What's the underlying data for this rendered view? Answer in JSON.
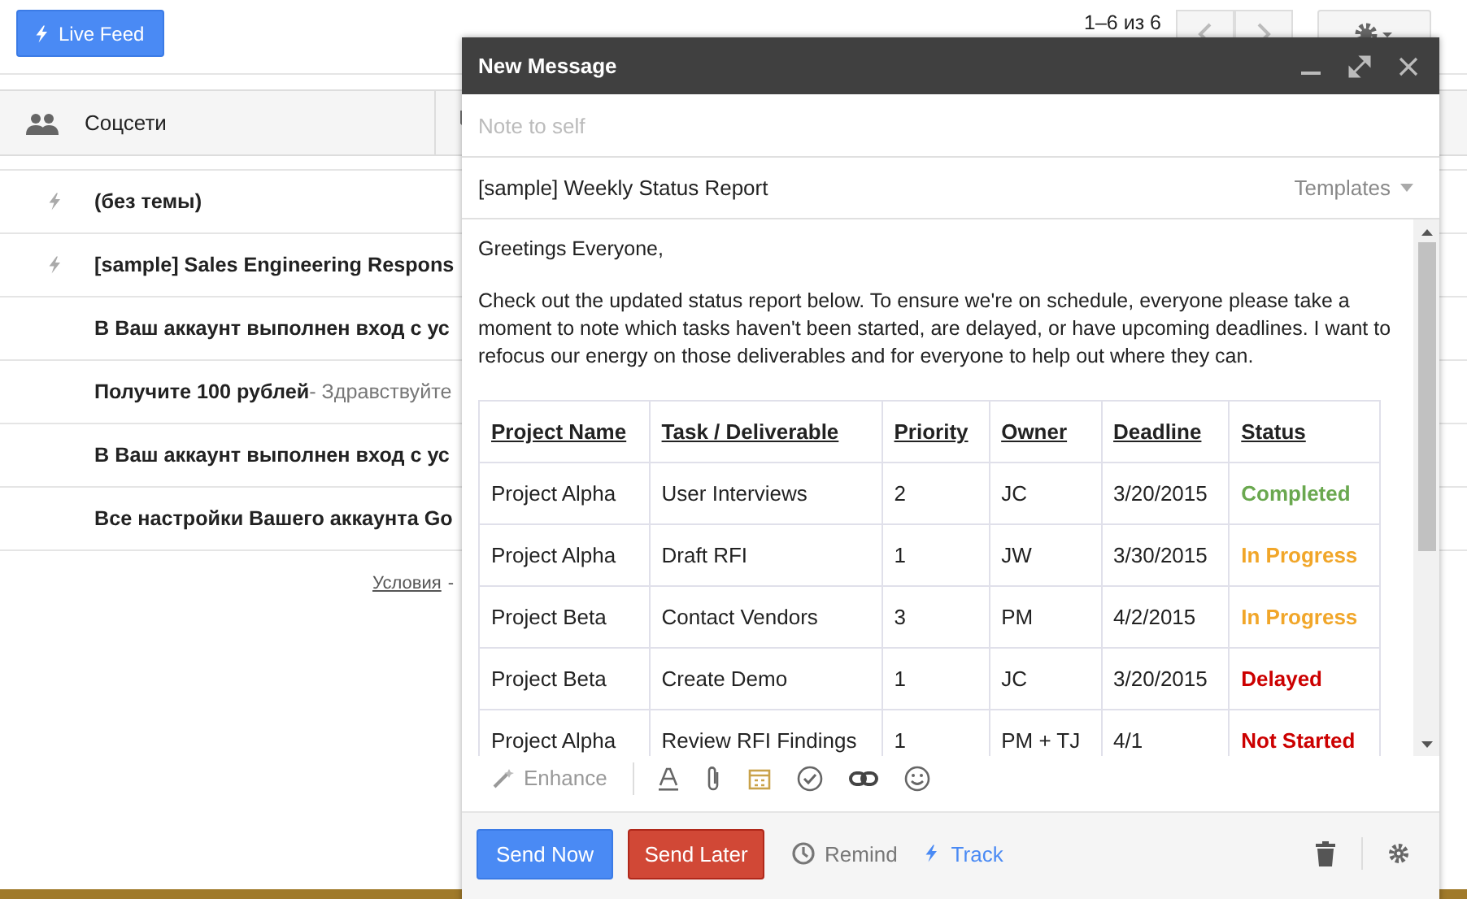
{
  "topbar": {
    "live_feed": "Live Feed",
    "page_count": "1–6 из 6"
  },
  "tabs": [
    {
      "label": "Соцсети"
    }
  ],
  "emails": [
    {
      "subject": "(без темы)",
      "tracked": true
    },
    {
      "subject": "[sample] Sales Engineering Respons",
      "tracked": true
    },
    {
      "subject": "В Ваш аккаунт выполнен вход с ус",
      "tracked": false
    },
    {
      "subject": "Получите 100 рублей",
      "snippet": " - Здравствуйте",
      "tracked": false
    },
    {
      "subject": "В Ваш аккаунт выполнен вход с ус",
      "tracked": false
    },
    {
      "subject": "Все настройки Вашего аккаунта Go",
      "tracked": false
    }
  ],
  "footer": {
    "link": "Условия",
    "separator": "-"
  },
  "compose": {
    "title": "New Message",
    "to_placeholder": "Note to self",
    "subject": "[sample] Weekly Status Report",
    "templates": "Templates",
    "paragraphs": [
      "Greetings Everyone,",
      "Check out the updated status report below. To ensure we're on schedule, everyone please take a moment to note which tasks haven't been started, are delayed, or have upcoming deadlines. I want to refocus our energy on those deliverables and for everyone to help out where they can."
    ],
    "table": {
      "columns": [
        "Project Name",
        "Task / Deliverable",
        "Priority",
        "Owner",
        "Deadline",
        "Status"
      ],
      "rows": [
        {
          "cells": [
            "Project Alpha",
            "User Interviews",
            "2",
            "JC",
            "3/20/2015"
          ],
          "status": "Completed",
          "color": "#6aa84f"
        },
        {
          "cells": [
            "Project Alpha",
            "Draft RFI",
            "1",
            "JW",
            "3/30/2015"
          ],
          "status": "In Progress",
          "color": "#f1a629"
        },
        {
          "cells": [
            "Project Beta",
            "Contact Vendors",
            "3",
            "PM",
            "4/2/2015"
          ],
          "status": "In Progress",
          "color": "#f1a629"
        },
        {
          "cells": [
            "Project Beta",
            "Create Demo",
            "1",
            "JC",
            "3/20/2015"
          ],
          "status": "Delayed",
          "color": "#cc0000"
        },
        {
          "cells": [
            "Project Alpha",
            "Review RFI Findings",
            "1",
            "PM + TJ",
            "4/1"
          ],
          "status": "Not Started",
          "color": "#cc0000"
        }
      ]
    },
    "enhance": "Enhance",
    "send_now": "Send Now",
    "send_later": "Send Later",
    "remind": "Remind",
    "track": "Track"
  }
}
